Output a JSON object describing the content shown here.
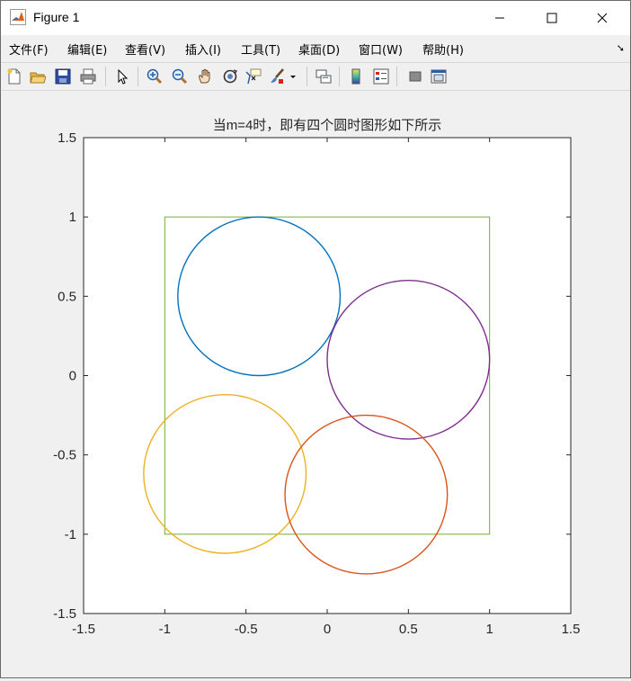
{
  "window": {
    "title": "Figure 1"
  },
  "window_controls": {
    "minimize": "—",
    "maximize": "☐",
    "close": "✕"
  },
  "menu": [
    {
      "label": "文件(F)",
      "key": "file"
    },
    {
      "label": "编辑(E)",
      "key": "edit"
    },
    {
      "label": "查看(V)",
      "key": "view"
    },
    {
      "label": "插入(I)",
      "key": "insert"
    },
    {
      "label": "工具(T)",
      "key": "tools"
    },
    {
      "label": "桌面(D)",
      "key": "desktop"
    },
    {
      "label": "窗口(W)",
      "key": "window"
    },
    {
      "label": "帮助(H)",
      "key": "help"
    }
  ],
  "toolbar_icons": [
    "new-figure-icon",
    "open-file-icon",
    "save-icon",
    "print-icon",
    "pointer-icon",
    "zoom-in-icon",
    "zoom-out-icon",
    "pan-hand-icon",
    "rotate-3d-icon",
    "data-cursor-icon",
    "brush-icon",
    "link-plot-icon",
    "colorbar-icon",
    "legend-icon",
    "hide-plot-tools-icon",
    "show-plot-tools-icon"
  ],
  "chart_data": {
    "type": "line",
    "title": "当m=4时，即有四个圆时图形如下所示",
    "xlabel": "",
    "ylabel": "",
    "xlim": [
      -1.5,
      1.5
    ],
    "ylim": [
      -1.5,
      1.5
    ],
    "xticks": [
      "-1.5",
      "-1",
      "-0.5",
      "0",
      "0.5",
      "1",
      "1.5"
    ],
    "yticks": [
      "1.5",
      "1",
      "0.5",
      "0",
      "-0.5",
      "-1",
      "-1.5"
    ],
    "xtick_values": [
      -1.5,
      -1,
      -0.5,
      0,
      0.5,
      1,
      1.5
    ],
    "ytick_values": [
      1.5,
      1,
      0.5,
      0,
      -0.5,
      -1,
      -1.5
    ],
    "grid": false,
    "square": {
      "x0": -1,
      "x1": 1,
      "y0": -1,
      "y1": 1,
      "color": "#77ac30"
    },
    "circles": [
      {
        "cx": -0.42,
        "cy": 0.5,
        "r": 0.5,
        "color": "#0072bd"
      },
      {
        "cx": 0.5,
        "cy": 0.1,
        "r": 0.5,
        "color": "#7e2f8e"
      },
      {
        "cx": -0.63,
        "cy": -0.62,
        "r": 0.5,
        "color": "#edb120"
      },
      {
        "cx": 0.24,
        "cy": -0.75,
        "r": 0.5,
        "color": "#d95319"
      }
    ]
  }
}
